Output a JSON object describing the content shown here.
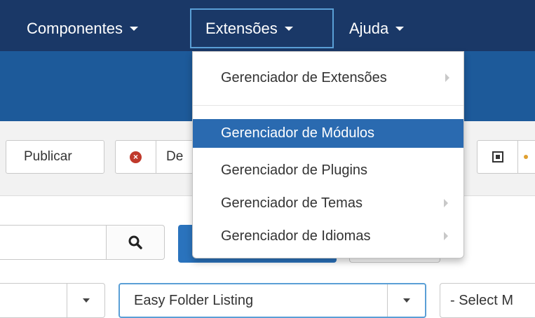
{
  "nav": {
    "componentes": "Componentes",
    "extensoes": "Extensões",
    "ajuda": "Ajuda"
  },
  "toolbar": {
    "publicar": "Publicar",
    "despublicar_partial": "De"
  },
  "dropdown": {
    "items": [
      {
        "label": "Gerenciador de Extensões",
        "has_submenu": true
      },
      {
        "label": "Gerenciador de Módulos",
        "active": true
      },
      {
        "label": "Gerenciador de Plugins"
      },
      {
        "label": "Gerenciador de Temas",
        "has_submenu": true
      },
      {
        "label": "Gerenciador de Idiomas",
        "has_submenu": true
      }
    ]
  },
  "filters": {
    "folder_value": "Easy Folder Listing",
    "select_partial": "- Select M"
  },
  "icons": {
    "search": "search-icon",
    "unpublish": "x-circle-icon",
    "square": "square-icon"
  },
  "colors": {
    "nav_bg": "#1a3867",
    "subheader_bg": "#1d5a9a",
    "active_item": "#2a6ab0",
    "primary_button": "#2a73bd"
  }
}
